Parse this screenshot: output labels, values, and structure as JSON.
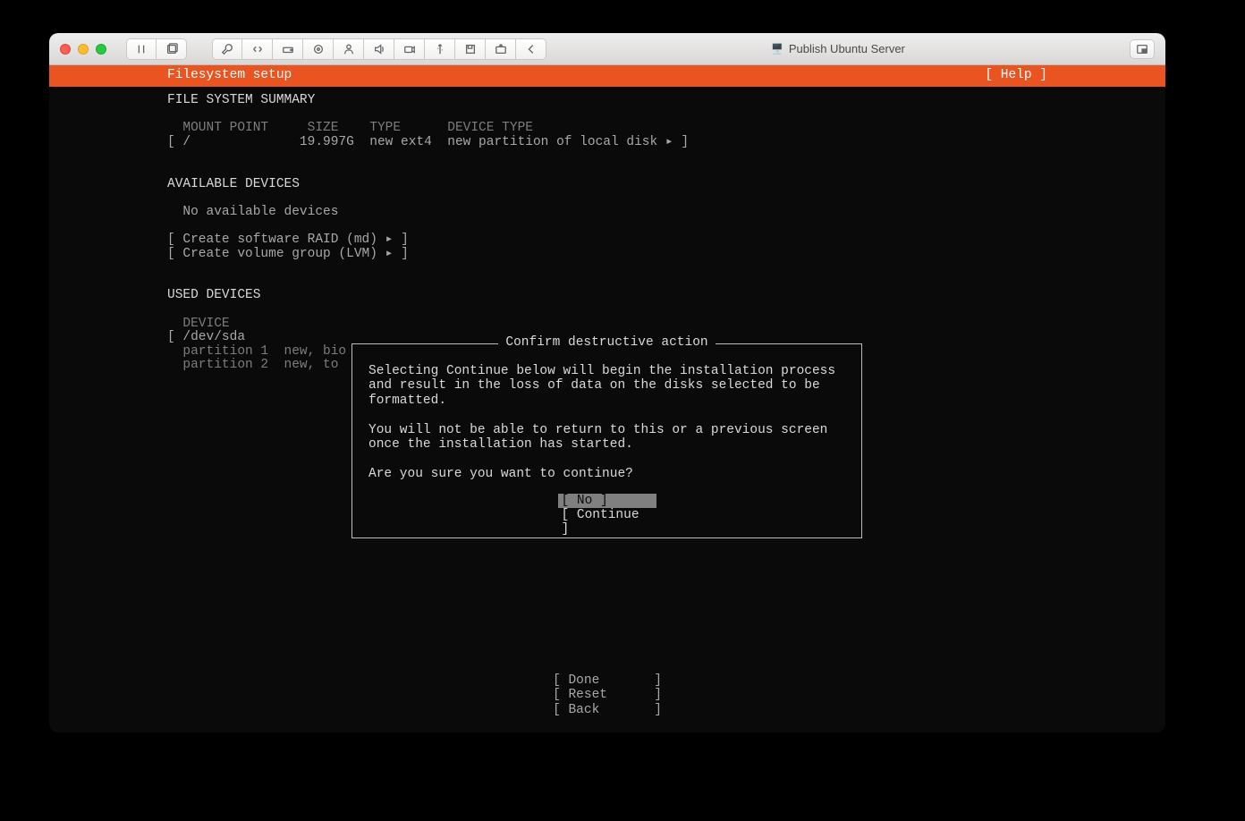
{
  "window": {
    "title": "Publish Ubuntu Server"
  },
  "header": {
    "title": "Filesystem setup",
    "help": "[ Help ]"
  },
  "summary": {
    "heading": "FILE SYSTEM SUMMARY",
    "columns": "  MOUNT POINT     SIZE    TYPE      DEVICE TYPE",
    "row": "[ /              19.997G  new ext4  new partition of local disk ▸ ]"
  },
  "available": {
    "heading": "AVAILABLE DEVICES",
    "none": "  No available devices",
    "raid": "[ Create software RAID (md) ▸ ]",
    "lvm": "[ Create volume group (LVM) ▸ ]"
  },
  "used": {
    "heading": "USED DEVICES",
    "col": "  DEVICE",
    "dev": "[ /dev/sda",
    "p1": "  partition 1  new, bio",
    "p2": "  partition 2  new, to"
  },
  "dialog": {
    "title": "Confirm destructive action",
    "p1": "Selecting Continue below will begin the installation process and result in the loss of data on the disks selected to be formatted.",
    "p2": "You will not be able to return to this or a previous screen once the installation has started.",
    "p3": "Are you sure you want to continue?",
    "no": "[ No        ]",
    "cont": "[ Continue  ]"
  },
  "footer": {
    "done": "[ Done       ]",
    "reset": "[ Reset      ]",
    "back": "[ Back       ]"
  }
}
